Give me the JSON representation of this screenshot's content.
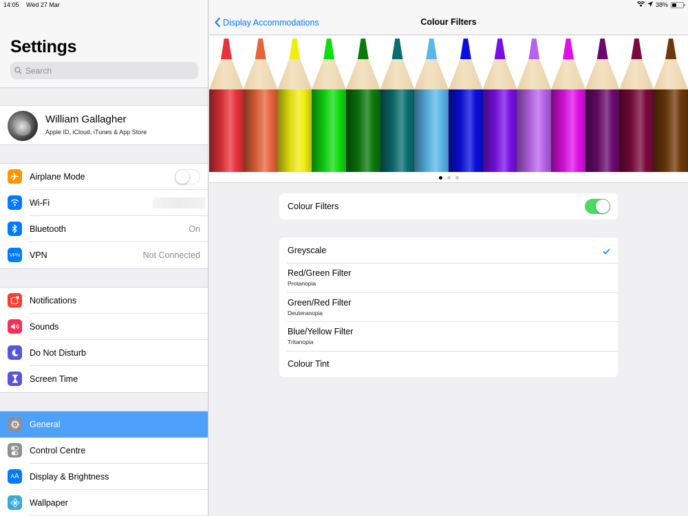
{
  "status_bar": {
    "time": "14:05",
    "date": "Wed 27 Mar",
    "battery_percent": "38%",
    "battery_level": 0.38,
    "icons": [
      "wifi-icon",
      "location-icon",
      "battery-icon"
    ]
  },
  "sidebar": {
    "title": "Settings",
    "search_placeholder": "Search",
    "profile": {
      "name": "William Gallagher",
      "subtitle": "Apple ID, iCloud, iTunes & App Store"
    },
    "groups": [
      [
        {
          "label": "Airplane Mode",
          "icon": "airplane-icon",
          "color": "#ff9500",
          "control": "toggle-off"
        },
        {
          "label": "Wi-Fi",
          "icon": "wifi-icon",
          "color": "#007aff",
          "value": ""
        },
        {
          "label": "Bluetooth",
          "icon": "bluetooth-icon",
          "color": "#007aff",
          "value": "On"
        },
        {
          "label": "VPN",
          "icon": "vpn-icon",
          "color": "#007aff",
          "value": "Not Connected"
        }
      ],
      [
        {
          "label": "Notifications",
          "icon": "notifications-icon",
          "color": "#ff3b30"
        },
        {
          "label": "Sounds",
          "icon": "sounds-icon",
          "color": "#ff2d55"
        },
        {
          "label": "Do Not Disturb",
          "icon": "moon-icon",
          "color": "#5856d6"
        },
        {
          "label": "Screen Time",
          "icon": "hourglass-icon",
          "color": "#5856d6"
        }
      ],
      [
        {
          "label": "General",
          "icon": "gear-icon",
          "color": "#8e8e93",
          "selected": true
        },
        {
          "label": "Control Centre",
          "icon": "switches-icon",
          "color": "#8e8e93"
        },
        {
          "label": "Display & Brightness",
          "icon": "text-size-icon",
          "color": "#007aff",
          "icon_text": "AA"
        },
        {
          "label": "Wallpaper",
          "icon": "flower-icon",
          "color": "#35aadc"
        }
      ]
    ],
    "selection_color": "#4ea1fa"
  },
  "main": {
    "back_label": "Display Accommodations",
    "title": "Colour Filters",
    "pencil_colors": [
      "#e8333a",
      "#e8643a",
      "#f0ee10",
      "#10dd10",
      "#0a7a0a",
      "#0a6e70",
      "#5bb7ea",
      "#0a0ee0",
      "#7a10e8",
      "#b864ea",
      "#e010e8",
      "#6a0a6e",
      "#7a0a3c",
      "#6e3a0a"
    ],
    "pagination": {
      "pages": 3,
      "current": 1
    },
    "colour_filters_toggle": {
      "label": "Colour Filters",
      "on": true
    },
    "options": [
      {
        "title": "Greyscale",
        "subtitle": "",
        "checked": true
      },
      {
        "title": "Red/Green Filter",
        "subtitle": "Protanopia",
        "checked": false
      },
      {
        "title": "Green/Red Filter",
        "subtitle": "Deuteranopia",
        "checked": false
      },
      {
        "title": "Blue/Yellow Filter",
        "subtitle": "Tritanopia",
        "checked": false
      },
      {
        "title": "Colour Tint",
        "subtitle": "",
        "checked": false
      }
    ],
    "accent_color": "#007aff",
    "toggle_on_color": "#4cd964"
  }
}
